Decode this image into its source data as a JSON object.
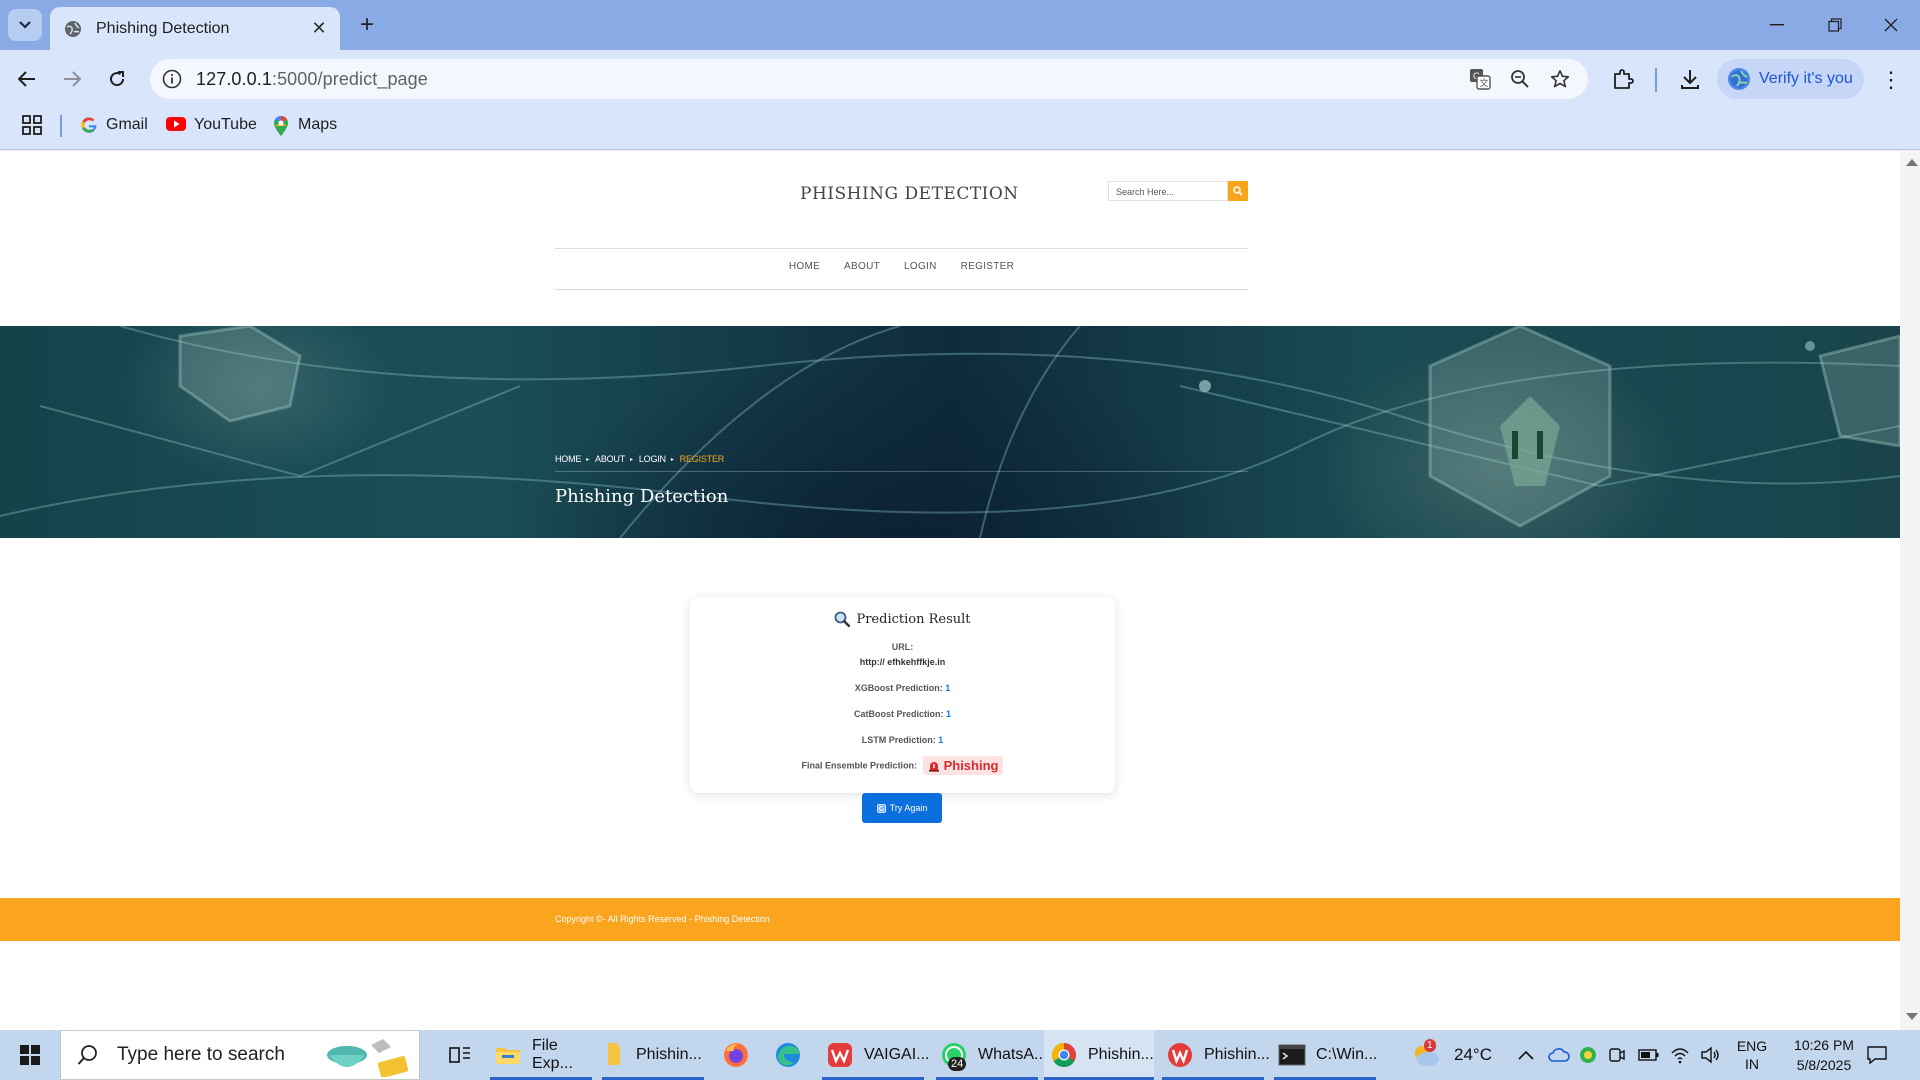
{
  "browser": {
    "tab_title": "Phishing Detection",
    "url_host": "127.0.0.1",
    "url_path": ":5000/predict_page",
    "verify_label": "Verify it's you",
    "bookmarks": [
      {
        "label": "Gmail",
        "icon": "gmail-icon"
      },
      {
        "label": "YouTube",
        "icon": "youtube-icon"
      },
      {
        "label": "Maps",
        "icon": "maps-icon"
      }
    ]
  },
  "site": {
    "title": "PHISHING DETECTION",
    "search_placeholder": "Search Here...",
    "nav": [
      "HOME",
      "ABOUT",
      "LOGIN",
      "REGISTER"
    ],
    "breadcrumb": [
      "HOME",
      "ABOUT",
      "LOGIN",
      "REGISTER"
    ],
    "hero_title": "Phishing Detection"
  },
  "result": {
    "title": "Prediction Result",
    "url_label": "URL:",
    "url_value": "http:// efhkehffkje.in",
    "xgboost_label": "XGBoost Prediction:",
    "xgboost_value": "1",
    "catboost_label": "CatBoost Prediction:",
    "catboost_value": "1",
    "lstm_label": "LSTM Prediction:",
    "lstm_value": "1",
    "final_label": "Final Ensemble Prediction:",
    "final_value": "Phishing",
    "try_again_label": "Try Again"
  },
  "footer": {
    "copyright": "Copyright ©- All Rights Reserved - Phishing Detection"
  },
  "taskbar": {
    "search_placeholder": "Type here to search",
    "apps": [
      {
        "label": "File Exp...",
        "icon": "file-explorer-icon"
      },
      {
        "label": "Phishin...",
        "icon": "folder-icon"
      },
      {
        "label": "",
        "icon": "firefox-icon"
      },
      {
        "label": "",
        "icon": "edge-icon"
      },
      {
        "label": "VAIGAI...",
        "icon": "wps-icon"
      },
      {
        "label": "WhatsA...",
        "icon": "whatsapp-icon"
      },
      {
        "label": "Phishin...",
        "icon": "chrome-icon"
      },
      {
        "label": "Phishin...",
        "icon": "wps-writer-icon"
      },
      {
        "label": "C:\\Win...",
        "icon": "terminal-icon"
      }
    ],
    "whatsapp_badge": "24",
    "weather_badge": "1",
    "temperature": "24°C",
    "language": "ENG",
    "region": "IN",
    "time": "10:26 PM",
    "date": "5/8/2025"
  }
}
